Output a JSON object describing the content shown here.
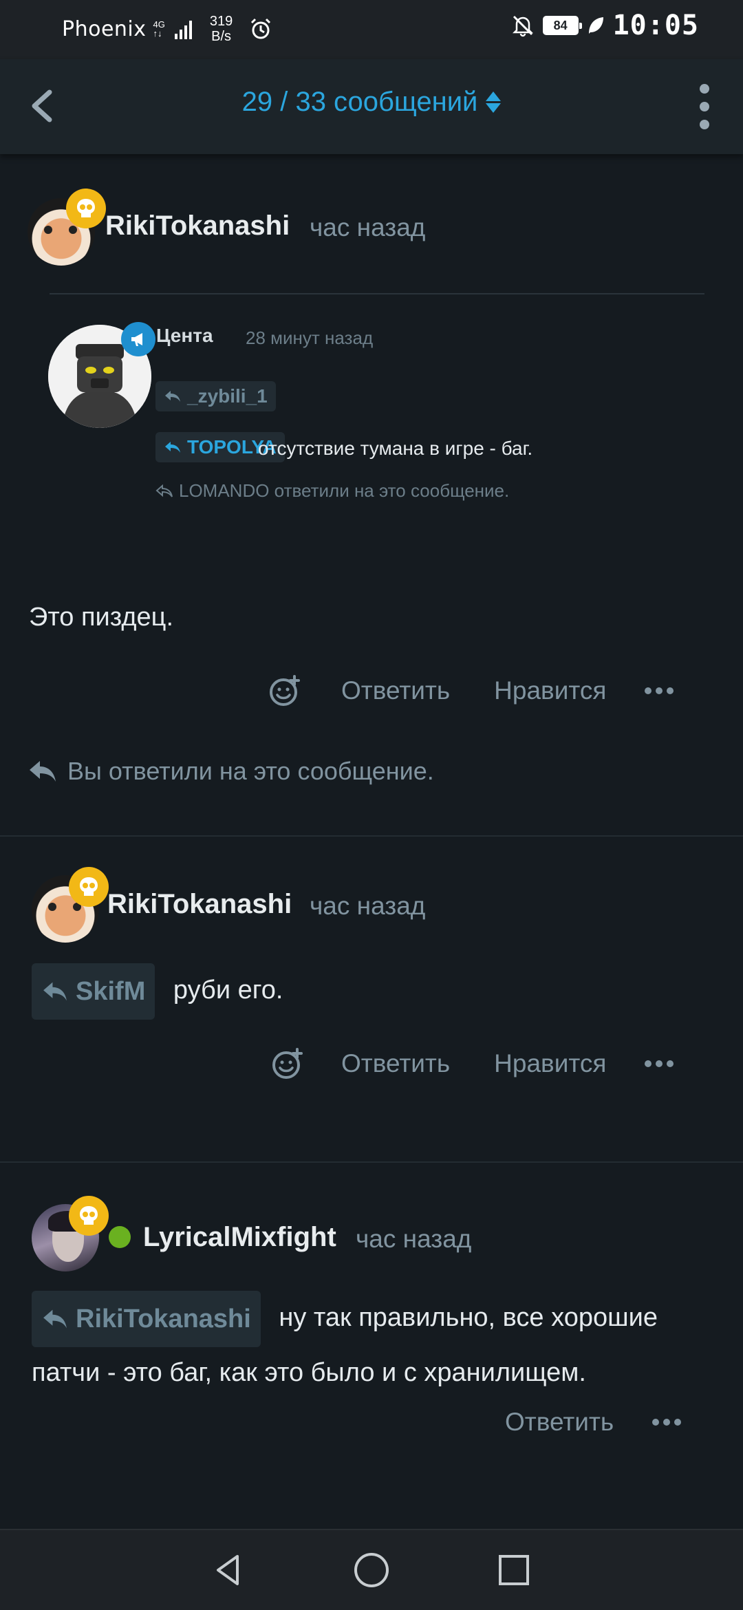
{
  "status_bar": {
    "carrier": "Phoenix",
    "network": "4G",
    "speed_value": "319",
    "speed_unit": "B/s",
    "battery": "84",
    "time": "10:05"
  },
  "app_bar": {
    "counter": "29 / 33 сообщений"
  },
  "posts": [
    {
      "username": "RikiTokanashi",
      "time": "час назад",
      "embed": {
        "name": "Цента",
        "time": "28 минут назад",
        "chip1": "_zybili_1",
        "chip2": "TOPOLYA",
        "text": "отсутствие тумана в игре - баг.",
        "note": "LOMANDO ответили на это сообщение."
      },
      "body": "Это пиздец.",
      "reply_label": "Ответить",
      "like_label": "Нравится",
      "replied_note": "Вы ответили на это сообщение."
    },
    {
      "username": "RikiTokanashi",
      "time": "час назад",
      "reply_to": "SkifM",
      "body": "руби его.",
      "reply_label": "Ответить",
      "like_label": "Нравится"
    },
    {
      "username": "LyricalMixfight",
      "time": "час назад",
      "reply_to": "RikiTokanashi",
      "body_line1": "ну так правильно, все хорошие",
      "body_line2": "патчи - это баг, как это было и с хранилищем.",
      "reply_label": "Ответить"
    }
  ],
  "colors": {
    "background": "#151b20",
    "accent": "#2ba6de",
    "muted": "#8194a0",
    "badge": "#f2b816",
    "online": "#6ab120"
  }
}
